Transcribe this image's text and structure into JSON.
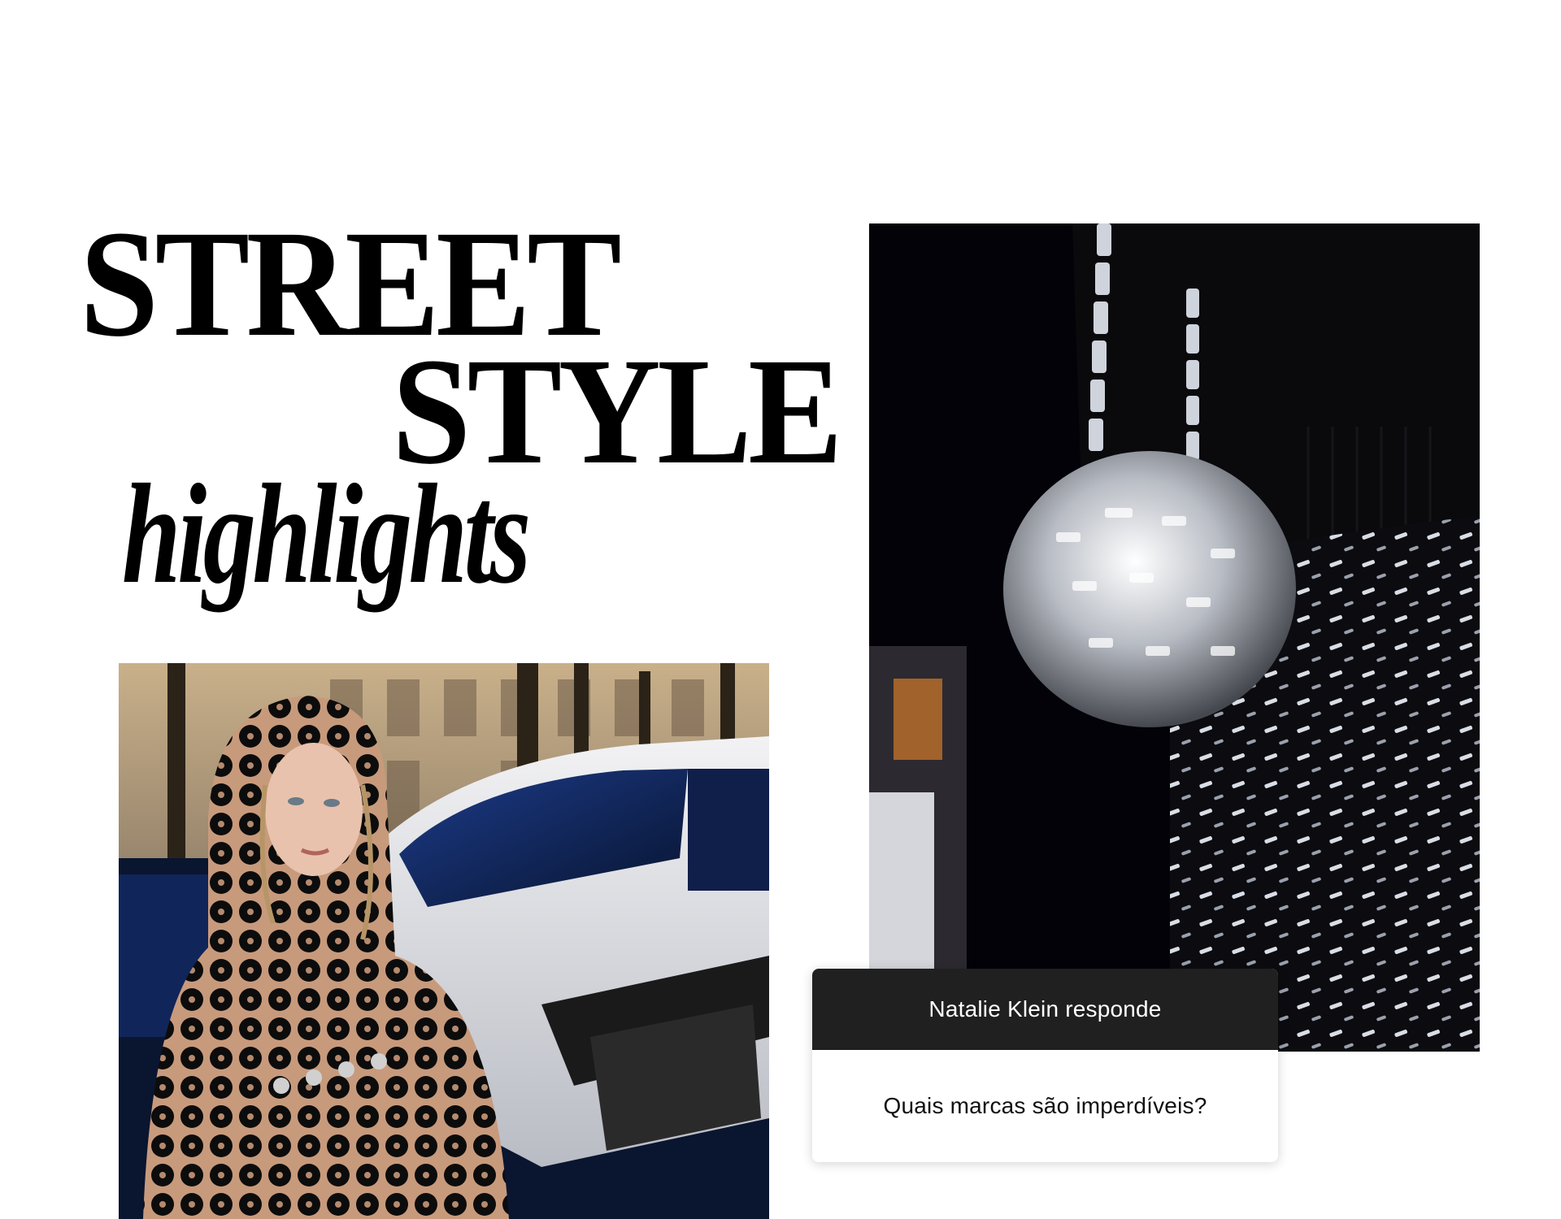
{
  "headline": {
    "line1": "STREET",
    "line2": "STYLE",
    "line3": "highlights"
  },
  "photos": {
    "left": {
      "subject": "street-style-sequin-look"
    },
    "right": {
      "subject": "disco-ball-bag-detail"
    }
  },
  "qa_card": {
    "header": "Natalie Klein responde",
    "question": "Quais marcas são imperdíveis?"
  },
  "colors": {
    "background": "#ffffff",
    "text": "#000000",
    "card_header": "#202020"
  }
}
